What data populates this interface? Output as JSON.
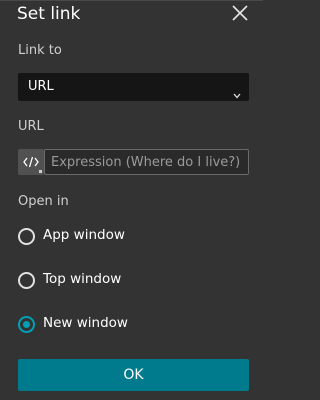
{
  "dialog": {
    "title": "Set link",
    "close_icon": "close-icon"
  },
  "link_to": {
    "label": "Link to",
    "selected": "URL"
  },
  "url": {
    "label": "URL",
    "expression_icon": "code-icon",
    "placeholder": "Expression (Where do I live?)"
  },
  "open_in": {
    "label": "Open in",
    "options": [
      {
        "label": "App window",
        "checked": false
      },
      {
        "label": "Top window",
        "checked": false
      },
      {
        "label": "New window",
        "checked": true
      }
    ]
  },
  "ok_button": {
    "label": "OK"
  },
  "colors": {
    "accent": "#00a0b6",
    "button": "#007b8e",
    "background": "#333333"
  }
}
